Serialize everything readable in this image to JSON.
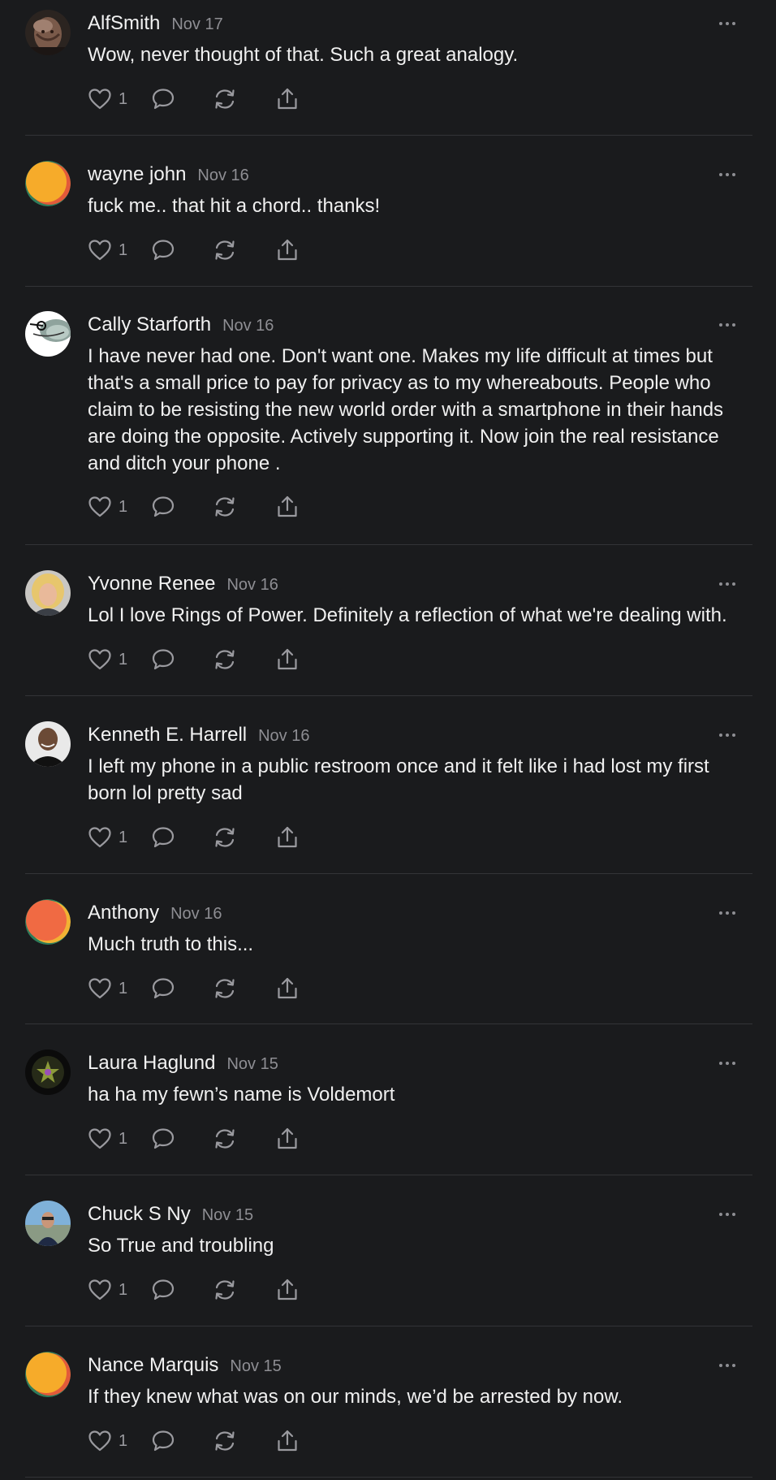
{
  "comments": [
    {
      "author": "AlfSmith",
      "date": "Nov 17",
      "text": "Wow, never thought of that. Such a great analogy.",
      "likes": "1",
      "avatar": "photo-elderly-man"
    },
    {
      "author": "wayne john",
      "date": "Nov 16",
      "text": "fuck me.. that hit a chord.. thanks!",
      "likes": "1",
      "avatar": "default-orange-gradient"
    },
    {
      "author": "Cally Starforth",
      "date": "Nov 16",
      "text": "I have never had one. Don't want one. Makes my life difficult at times but that's a small price to pay for privacy as to my whereabouts. People who claim to be resisting the new world order with a smartphone in their hands are doing the opposite. Actively supporting it. Now join the real resistance and ditch your phone .",
      "likes": "1",
      "avatar": "illustration-seal"
    },
    {
      "author": "Yvonne Renee",
      "date": "Nov 16",
      "text": "Lol I love Rings of Power. Definitely a reflection of what we're dealing with.",
      "likes": "1",
      "avatar": "photo-blonde-woman"
    },
    {
      "author": "Kenneth E. Harrell",
      "date": "Nov 16",
      "text": "I left my phone in a public restroom once and it felt like i had lost my first born lol pretty sad",
      "likes": "1",
      "avatar": "photo-man-portrait"
    },
    {
      "author": "Anthony",
      "date": "Nov 16",
      "text": "Much truth to this...",
      "likes": "1",
      "avatar": "default-red-gradient"
    },
    {
      "author": "Laura Haglund",
      "date": "Nov 15",
      "text": "ha ha my fewn’s name is Voldemort",
      "likes": "1",
      "avatar": "star-emblem"
    },
    {
      "author": "Chuck S Ny",
      "date": "Nov 15",
      "text": "So True and troubling",
      "likes": "1",
      "avatar": "photo-man-outdoors"
    },
    {
      "author": "Nance Marquis",
      "date": "Nov 15",
      "text": "If they knew what was on our minds, we’d be arrested by now.",
      "likes": "1",
      "avatar": "default-orange-gradient"
    }
  ],
  "icons": {
    "like": "heart-icon",
    "reply": "speech-bubble-icon",
    "restack": "restack-icon",
    "share": "share-icon",
    "more": "ellipsis-icon"
  },
  "colors": {
    "background": "#1a1b1d",
    "text": "#f0f0f0",
    "muted": "#8e8e93",
    "divider": "#333437"
  }
}
